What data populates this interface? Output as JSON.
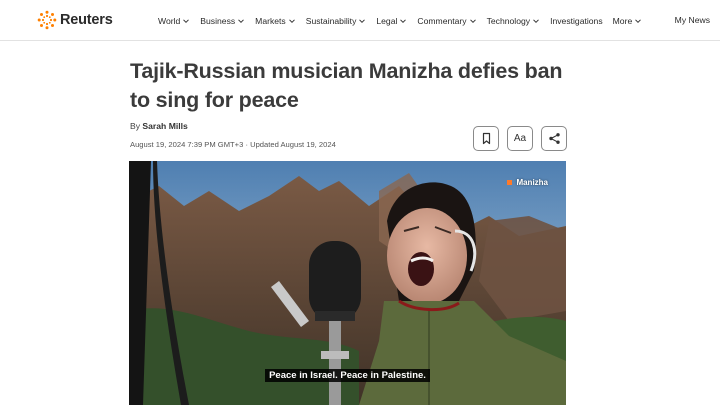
{
  "header": {
    "logo_text": "Reuters",
    "nav": [
      {
        "label": "World",
        "has_menu": true
      },
      {
        "label": "Business",
        "has_menu": true
      },
      {
        "label": "Markets",
        "has_menu": true
      },
      {
        "label": "Sustainability",
        "has_menu": true
      },
      {
        "label": "Legal",
        "has_menu": true
      },
      {
        "label": "Commentary",
        "has_menu": true
      },
      {
        "label": "Technology",
        "has_menu": true
      },
      {
        "label": "Investigations",
        "has_menu": false
      },
      {
        "label": "More",
        "has_menu": true
      }
    ],
    "my_news": "My News"
  },
  "article": {
    "title": "Tajik-Russian musician Manizha defies ban to sing for peace",
    "by_prefix": "By",
    "author": "Sarah Mills",
    "dateline": "August 19, 2024 7:39 PM GMT+3 · Updated August 19, 2024",
    "tools": {
      "bookmark_icon": "bookmark-icon",
      "text_size_label": "Aa",
      "share_icon": "share-icon"
    }
  },
  "media": {
    "watermark": "Manizha",
    "subtitle": "Peace in Israel. Peace in Palestine."
  },
  "colors": {
    "brand_orange": "#ff8000",
    "tagline_dot": "#ff7a2a"
  }
}
